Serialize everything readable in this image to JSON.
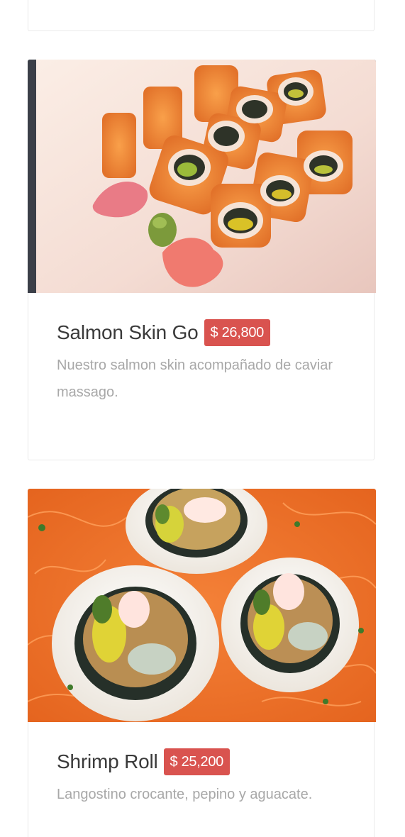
{
  "menu": {
    "items": [
      {
        "name": "Salmon Skin Go",
        "price": "$ 26,800",
        "description": "Nuestro salmon skin acompañado de caviar massago."
      },
      {
        "name": "Shrimp Roll",
        "price": "$ 25,200",
        "description": "Langostino crocante, pepino y aguacate."
      }
    ]
  },
  "colors": {
    "price_badge": "#d9534f",
    "description_text": "#a8a8a8",
    "title_text": "#3a3a3a",
    "card_border": "#e9e9e9"
  }
}
